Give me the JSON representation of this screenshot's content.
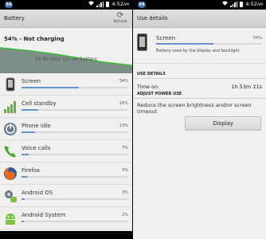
{
  "status_bars": [
    {
      "badge": "54",
      "time": "4:52",
      "ampm": "AM"
    },
    {
      "badge": "54",
      "time": "4:52",
      "ampm": "AM"
    }
  ],
  "left": {
    "title": "Battery",
    "refresh_label": "Refresh",
    "status": "54% - Not charging",
    "graph_label": "1d 6h 28m 51s on battery",
    "items": [
      {
        "name": "Screen",
        "percent": "54%",
        "value": 54,
        "icon": "phone-icon"
      },
      {
        "name": "Cell standby",
        "percent": "16%",
        "value": 16,
        "icon": "signal-bars-icon"
      },
      {
        "name": "Phone idle",
        "percent": "13%",
        "value": 13,
        "icon": "power-icon"
      },
      {
        "name": "Voice calls",
        "percent": "7%",
        "value": 7,
        "icon": "phone-handset-icon"
      },
      {
        "name": "Firefox",
        "percent": "5%",
        "value": 5,
        "icon": "firefox-icon"
      },
      {
        "name": "Android OS",
        "percent": "3%",
        "value": 3,
        "icon": "android-os-icon"
      },
      {
        "name": "Android System",
        "percent": "2%",
        "value": 2,
        "icon": "android-system-icon"
      }
    ]
  },
  "right": {
    "title": "Use details",
    "item_name": "Screen",
    "item_percent": "54%",
    "item_value": 54,
    "item_desc": "Battery used by the display and backlight",
    "use_details_heading": "USE DETAILS",
    "time_on_label": "Time on",
    "time_on_value": "1h 53m 21s",
    "adjust_heading": "ADJUST POWER USE",
    "adjust_text": "Reduce the screen brightness and/or screen timeout",
    "display_button": "Display"
  },
  "colors": {
    "accent_bar": "#6d91c9",
    "graph_fill": "#7d8f86",
    "graph_line": "#3dbb3d"
  }
}
